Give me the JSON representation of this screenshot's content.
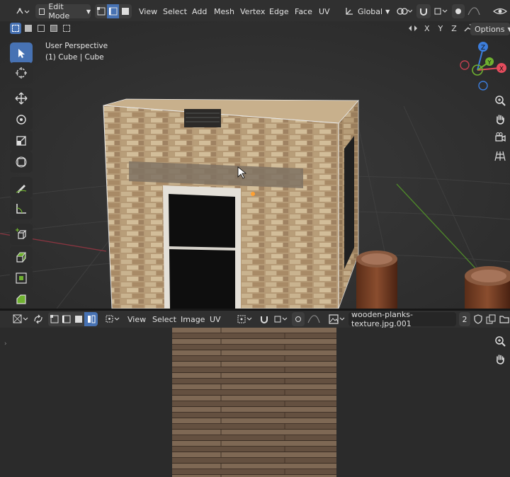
{
  "top_header": {
    "mode": "Edit Mode",
    "menus": [
      "View",
      "Select",
      "Add",
      "Mesh",
      "Vertex",
      "Edge",
      "Face",
      "UV"
    ],
    "transform_orientation": "Global",
    "axes": [
      "X",
      "Y",
      "Z"
    ],
    "options_label": "Options"
  },
  "viewport": {
    "perspective_label": "User Perspective",
    "object_label": "(1) Cube | Cube",
    "gizmo": {
      "x": "X",
      "y": "Y",
      "z": "Z"
    }
  },
  "uv_header": {
    "menus": [
      "View",
      "Select",
      "Image",
      "UV"
    ],
    "image_name": "wooden-planks-texture.jpg.001",
    "user_count": "2"
  },
  "colors": {
    "selection_blue": "#4772b3",
    "axis_x": "#e54c5d",
    "axis_y": "#6fb130",
    "axis_z": "#3c7ddb"
  }
}
